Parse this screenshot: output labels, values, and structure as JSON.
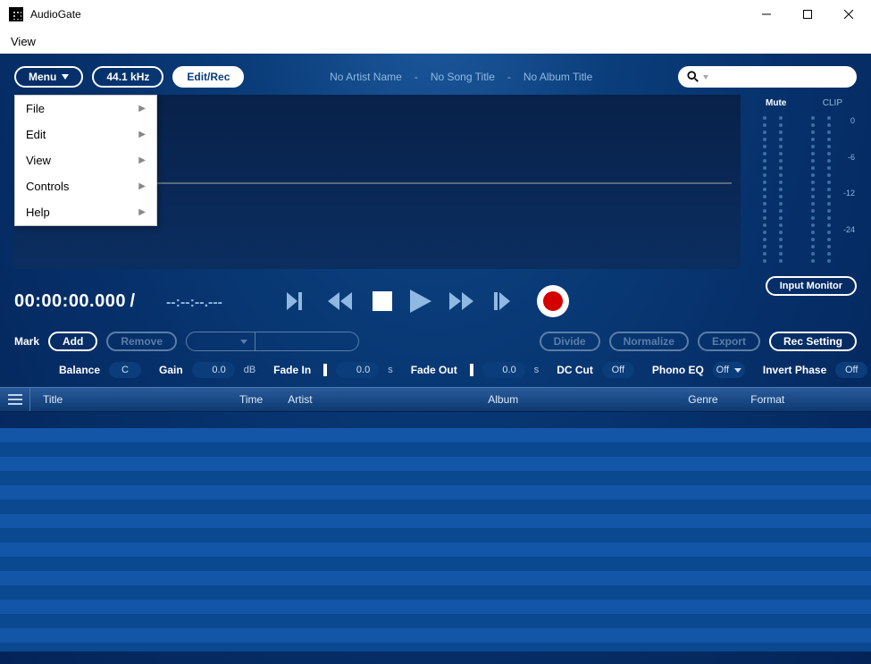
{
  "window": {
    "title": "AudioGate"
  },
  "menubar": {
    "view": "View"
  },
  "toprow": {
    "menu": "Menu",
    "rate": "44.1 kHz",
    "editrec": "Edit/Rec"
  },
  "meta": {
    "artist": "No Artist Name",
    "song": "No Song Title",
    "album": "No Album Title",
    "sep": "-"
  },
  "meters": {
    "mute": "Mute",
    "clip": "CLIP",
    "ticks": [
      "0",
      "-6",
      "-12",
      "-24"
    ]
  },
  "input_monitor": "Input Monitor",
  "time": {
    "current": "00:00:00.000",
    "slash": "/",
    "total": "--:--:--.---"
  },
  "mark": {
    "label": "Mark",
    "add": "Add",
    "remove": "Remove",
    "divide": "Divide",
    "normalize": "Normalize",
    "export": "Export",
    "recsetting": "Rec Setting"
  },
  "params": {
    "balance_lbl": "Balance",
    "balance_val": "C",
    "gain_lbl": "Gain",
    "gain_val": "0.0",
    "gain_unit": "dB",
    "fadein_lbl": "Fade In",
    "fadein_val": "0.0",
    "s": "s",
    "fadeout_lbl": "Fade Out",
    "fadeout_val": "0.0",
    "dccut_lbl": "DC Cut",
    "dccut_val": "Off",
    "phono_lbl": "Phono EQ",
    "phono_val": "Off",
    "invert_lbl": "Invert Phase",
    "invert_val": "Off"
  },
  "playlist": {
    "cols": {
      "title": "Title",
      "time": "Time",
      "artist": "Artist",
      "album": "Album",
      "genre": "Genre",
      "format": "Format"
    }
  },
  "menu_popup": {
    "items": [
      "File",
      "Edit",
      "View",
      "Controls",
      "Help"
    ]
  }
}
